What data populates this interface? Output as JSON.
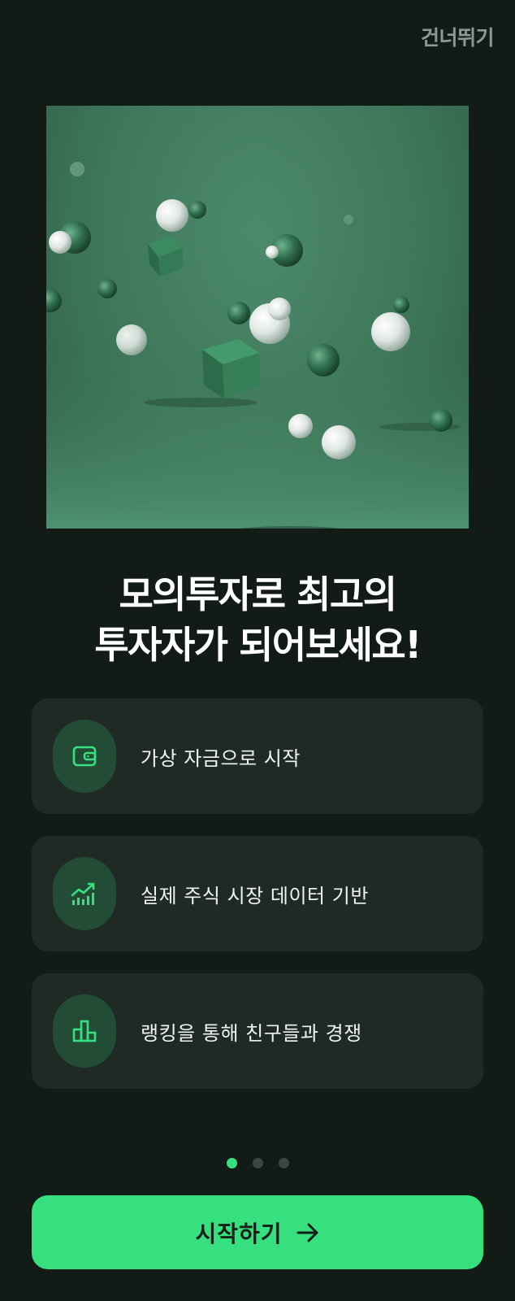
{
  "header": {
    "skip_label": "건너뛰기"
  },
  "hero": {
    "image_alt": ""
  },
  "headline": {
    "line1": "모의투자로 최고의",
    "line2": "투자자가 되어보세요!"
  },
  "features": [
    {
      "icon": "wallet-icon",
      "label": "가상 자금으로 시작"
    },
    {
      "icon": "chart-trend-icon",
      "label": "실제 주식 시장 데이터 기반"
    },
    {
      "icon": "bar-chart-icon",
      "label": "랭킹을 통해 친구들과 경쟁"
    }
  ],
  "pagination": {
    "total": 3,
    "active": 1
  },
  "cta": {
    "label": "시작하기",
    "icon": "arrow-right-icon"
  },
  "colors": {
    "accent": "#37e07e",
    "background": "#131b17",
    "card": "#1f2a24",
    "icon_bg": "#234c36"
  }
}
